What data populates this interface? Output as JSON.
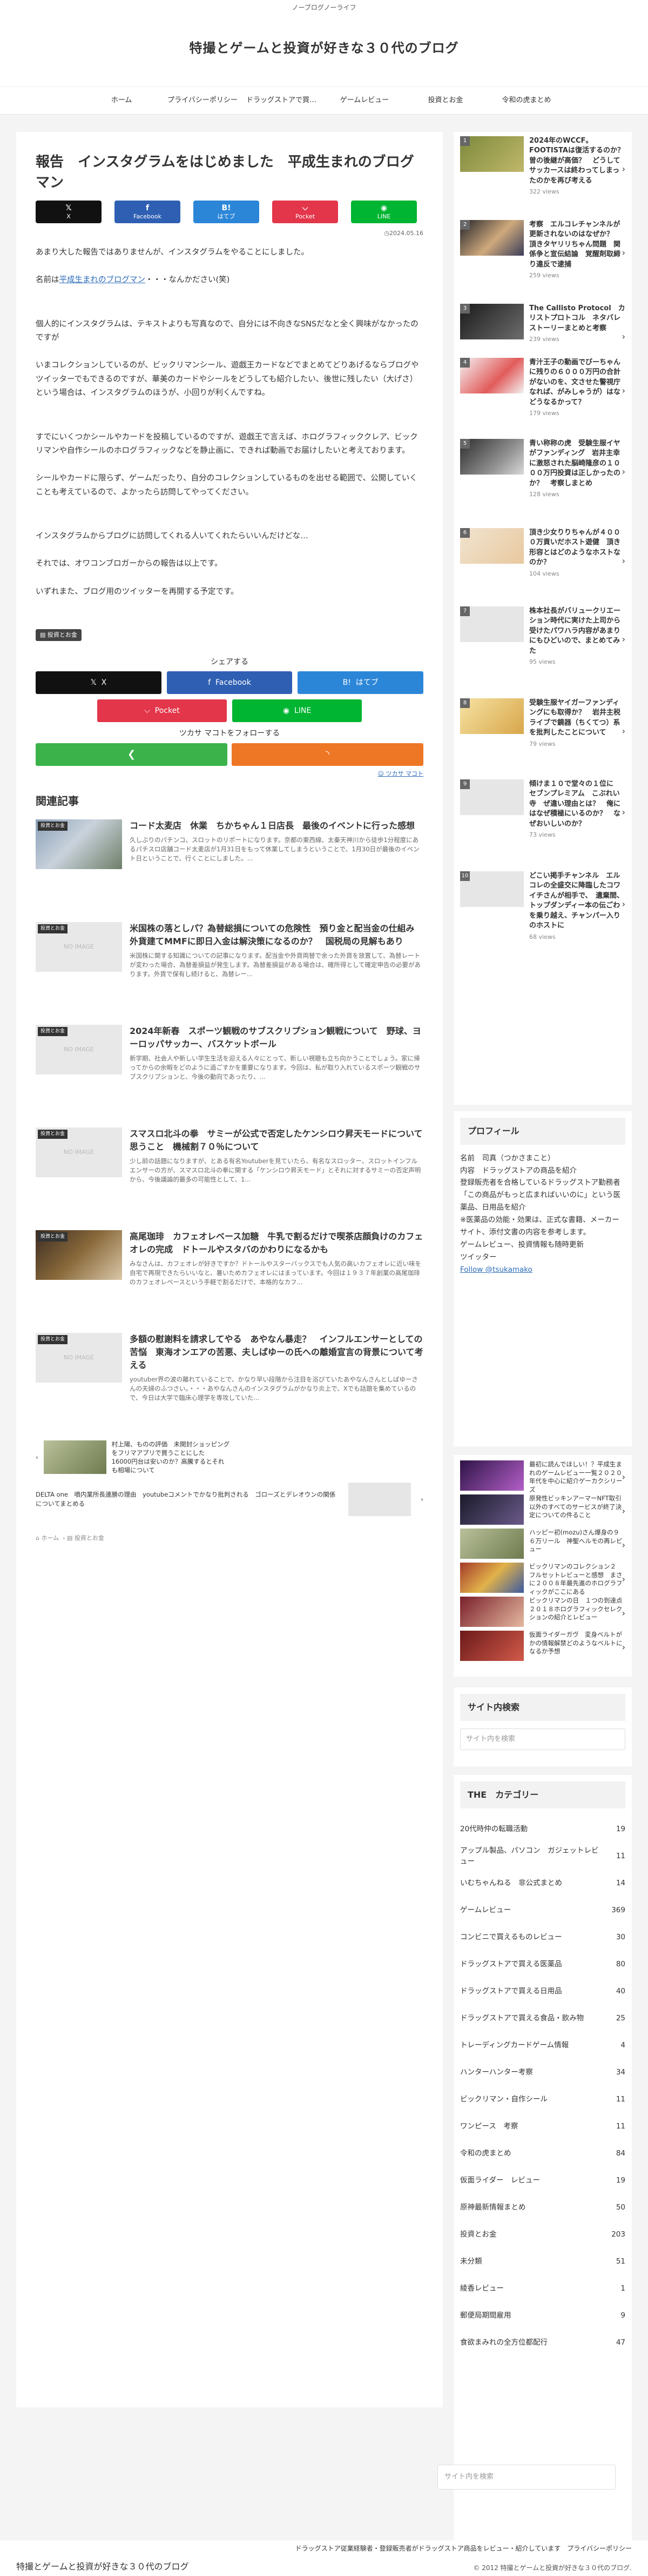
{
  "top_bar": "ノーブログノーライフ",
  "site_title": "特撮とゲームと投資が好きな３０代のブログ",
  "nav": [
    "ホーム",
    "プライバシーポリシー",
    "ドラッグストアで買え...",
    "ゲームレビュー",
    "投資とお金",
    "令和の虎まとめ"
  ],
  "article": {
    "title": "報告　インスタグラムをはじめました　平成生まれのブログマン",
    "share": {
      "x": "X",
      "facebook": "Facebook",
      "hatena": "はてブ",
      "pocket": "Pocket",
      "line": "LINE"
    },
    "date": "2024.05.16",
    "para1": "あまり大した報告ではありませんが、インスタグラムをやることにしました。",
    "para2_pre": "名前は",
    "para2_link": "平成生まれのブログマン",
    "para2_post": "・・・なんかださい(笑)",
    "para3": "個人的にインスタグラムは、テキストよりも写真なので、自分には不向きなSNSだなと全く興味がなかったのですが",
    "para4": "いまコレクションしているのが、ビックリマンシール、遊戯王カードなどでまとめてどりあげるならブログやツイッターでもできるのですが、華美のカードやシールをどうしても紹介したい、後世に残したい（大げさ）という場合は、インスタグラムのほうが、小回りが利くんですね。",
    "para5": "すでにいくつかシールやカードを投稿しているのですが、遊戯王で言えば、ホログラフィッククレア、ビックリマンや自作シールのホログラフィックなどを静止画に、できれば動画でお届けしたいと考えております。",
    "para6": "シールやカードに限らず、ゲームだったり、自分のコレクションしているものを出せる範囲で、公開していくことも考えているので、よかったら訪問してやってください。",
    "para7": "インスタグラムからブログに訪問してくれる人いてくれたらいいんだけどな…",
    "para8": "それでは、オワコンブロガーからの報告は以上です。",
    "para9": "いずれまた、ブログ用のツイッターを再開する予定です。",
    "tag": "投資とお金"
  },
  "share_bottom": {
    "caption": "シェアする",
    "x": "X",
    "facebook": "Facebook",
    "hatena": "はてブ",
    "pocket": "Pocket",
    "line": "LINE",
    "follow_caption": "ツカサ マコトをフォローする",
    "feedly_icon": "feedly-icon",
    "rss_icon": "rss-icon",
    "feedly_link": "ツカサ マコト"
  },
  "related": {
    "heading": "関連記事",
    "noimage": "NO IMAGE",
    "items": [
      {
        "cat": "投資とお金",
        "title": "コード太麦店　休業　ちかちゃん１日店長　最後のイベントに行った感想",
        "snip": "久しぶりのパチンコ、スロットのリポートになります。京都の東西線、太秦天神川から徒歩1分程度にあるパチスロ店舗コード太麦店が1月31日をもって休業してしまうということで、1月30日が最後のイベント日ということで、行くことにしました。..."
      },
      {
        "cat": "投資とお金",
        "title": "米国株の落としパ？為替総損についての危険性　預り金と配当金の仕組み　外貨建てMMFに即日入金は解決策になるのか？　国税局の見解もあり",
        "snip": "米国株に関する知識についての記事になります。配当金や外貨両替で余った外貨を放置して、為替レートが変わった場合、為替差損益が発生します。為替差損益がある場合は、確所得として確定申告の必要があります。外貨で保有し続けると、為替レー..."
      },
      {
        "cat": "投資とお金",
        "title": "2024年新春　スポーツ観戦のサブスクリプション観戦について　野球、ヨーロッパサッカー、バスケットボール",
        "snip": "新学期、社会人や新しい学生生活を迎える人々にとって、新しい視聴も立ち向かうことでしょう。家に帰ってからの余暇をどのように過ごすかを重要になります。今回は、私が取り入れているスポーツ観戦のサブスクリプションと、今後の動向であったり、..."
      },
      {
        "cat": "投資とお金",
        "title": "スマスロ北斗の拳　サミーが公式で否定したケンシロウ昇天モードについて思うこと　機械割７０％について",
        "snip": "少し前の話題になりますが、とある有名Youtuberを見ていたら、有名なスロッター、スロットインフルエンサーの方が、スマスロ北斗の拳に関する「ケンシロウ昇天モード」とそれに対するサミーの否定声明から、今後議論的最多の可能性として、1..."
      },
      {
        "cat": "投資とお金",
        "title": "高尾珈琲　カフェオレベース加糖　牛乳で割るだけで喫茶店顔負けのカフェオレの完成　ドトールやスタバのかわりになるかも",
        "snip": "みなさんは、カフェオレが好きですか？ドトールやスターバックスでも人気の高いカフェオレに近い味を自宅で再現できたらいいなと、暑いためカフェオレにはまっています。今回は１９３７年創業の高尾珈琲のカフェオレベースという手軽で割るだけで、本格的なカフ..."
      },
      {
        "cat": "投資とお金",
        "title": "多額の慰謝料を請求してやる　あやなん暴走？　インフルエンサーとしての苦悩　東海オンエアの苦悪、夫しばゆーの氏への離婚宣言の背景について考える",
        "snip": "youtuber界の波の離れていることで、かなり早い段階から注目を浴びていたあやなんさんとしばゆーさんの夫婦のふつさい。・・・あやなんさんのインスタグラムがかなり炎上で、Xでも話題を集めているので、今日は大学で臨床心理学を専攻していた..."
      }
    ]
  },
  "pager": {
    "prev": "村上陽、ものの評価　未開封ショッピングをフリマアプリで買うことにした　16000円台は安いのか？高騰するとそれも相場について",
    "next": "DELTA one　噴内業所長連勝の理由　youtubeコメントでかなり批判される　ゴローズとデレオウンの関係についてまとめる"
  },
  "foot_meta": {
    "home": "ホーム",
    "category": "投資とお金"
  },
  "popular": [
    {
      "title": "2024年のWCCF。FOOTISTAは復活するのか？　曽の後継が高価？　どうしてサッカースは終わってしまったのかを再び考える",
      "views": "322 views"
    },
    {
      "title": "考察　エルコレチャンネルが更新されないのはなぜか？　頂きタヤリリちゃん問題　関係争と宣伝結論　覚醒剤取締り違反で逮捕",
      "views": "259 views"
    },
    {
      "title": "The Callisto Protocol　カリストプロトコル　ネタバレ　ストーリーまとめと考察",
      "views": "239 views"
    },
    {
      "title": "青汁王子の動画でびーちゃんに残りの６０００万円の合計がないのを、文させた警視庁なれば、がみしゃうが）はなどうなるかって？",
      "views": "179 views"
    },
    {
      "title": "青い称称の虎　受験生服イヤがファンディング　岩井主幸に激怒された脳崎隆彦の１０００万円投資は正しかったのか？　考察しまとめ",
      "views": "128 views"
    },
    {
      "title": "頂き少女りりちゃんが４０００万貢いだホスト遊健　頂き形容とはどのようなホストなのか？",
      "views": "104 views"
    },
    {
      "title": "株本社長がバリュークリエーション時代に実けた上司から受けたパワハラ内容があまりにもひどいので、まとめてみた",
      "views": "95 views"
    },
    {
      "title": "受験生服ヤイガーファンディングにも取得か？　岩井主税　ライブで鏡器（ちくてつ）系を批判したことについて",
      "views": "79 views"
    },
    {
      "title": "傾けま１０で堂々の１位に　セブンプレミアム　こぶれい寺　ぜ違い理由とは？　俺にはなぜ積極にいるのか？　なぜおいしいのか？",
      "views": "73 views"
    },
    {
      "title": "どこい掲手チャンネル　エルコレの全盛交に降臨したコワイチさんが相手で、　遺棄間、トップダンディー本の伝ごわを乗り越え、チャンパー入りのホストに",
      "views": "68 views"
    }
  ],
  "profile": {
    "heading": "プロフィール",
    "name": "名前　司真（つかさまこと）",
    "content": "内容　ドラッグストアの商品を紹介",
    "qual": "登録販売者を合格しているドラッグストア勤務者",
    "quote": "「この商品がもっと広まればいいのに」という医薬品、日用品を紹介",
    "medical": "※医薬品の効能・効果は、正式な書籍、メーカーサイト、添付文書の内容を参考します。",
    "interest": "ゲームレビュー、投資情報も随時更新",
    "twitter": "ツイッター",
    "follow": "Follow @tsukamako"
  },
  "recent": [
    "最初に読んでほしい！？平成生まれのゲームレビュー一覧２０２０年代を中心に紹介ゲーカクシリーズ",
    "原発性ビッキンアーマーNFT取引以外のすべてのサービスが終了決定についての件ること",
    "ハッピー初(mozu)さん爆身の９６万リール　神聖ヘルモの再レビュー",
    "ビックリマンのコレクション２　フルセットレビューと感想　まさに２００８年最先進のホログラフィックがここにある",
    "ビックリマンの日　１つの到達点　２０１８ホログラフィックセレクションの紹介とレビュー",
    "仮面ライダーガヴ　変身ベルトがかの情報解禁どのようなベルトになるか予想"
  ],
  "search": {
    "placeholder": "サイト内を検索",
    "heading": "サイト内検索"
  },
  "categories": {
    "heading": "THE　カテゴリー",
    "items": [
      {
        "name": "20代時仲の転職活動",
        "count": "19"
      },
      {
        "name": "アップル製品、パソコン　ガジェットレビュー",
        "count": "11"
      },
      {
        "name": "いむちゃんねる　非公式まとめ",
        "count": "14"
      },
      {
        "name": "ゲームレビュー",
        "count": "369"
      },
      {
        "name": "コンビニで買えるものレビュー",
        "count": "30"
      },
      {
        "name": "ドラッグストアで買える医薬品",
        "count": "80"
      },
      {
        "name": "ドラッグストアで買える日用品",
        "count": "40"
      },
      {
        "name": "ドラッグストアで買える食品・飲み物",
        "count": "25"
      },
      {
        "name": "トレーディングカードゲーム情報",
        "count": "4"
      },
      {
        "name": "ハンターハンター考察",
        "count": "34"
      },
      {
        "name": "ビックリマン・自作シール",
        "count": "11"
      },
      {
        "name": "ワンピース　考察",
        "count": "11"
      },
      {
        "name": "令和の虎まとめ",
        "count": "84"
      },
      {
        "name": "仮面ライダー　レビュー",
        "count": "19"
      },
      {
        "name": "原神最新情報まとめ",
        "count": "50"
      },
      {
        "name": "投資とお金",
        "count": "203"
      },
      {
        "name": "未分類",
        "count": "51"
      },
      {
        "name": "綾香レビュー",
        "count": "1"
      },
      {
        "name": "郵便局期間雇用",
        "count": "9"
      },
      {
        "name": "食欲まみれの全方位都配行",
        "count": "47"
      }
    ]
  },
  "footer": {
    "search_placeholder": "サイト内を検索",
    "title": "特撮とゲームと投資が好きな３０代のブログ",
    "links": "ドラッグストア従業経験者・登録販売者がドラッグストア商品をレビュー・紹介しています　プライバシーポリシー",
    "copyright": "© 2012 特撮とゲームと投資が好きな３０代のブログ."
  }
}
